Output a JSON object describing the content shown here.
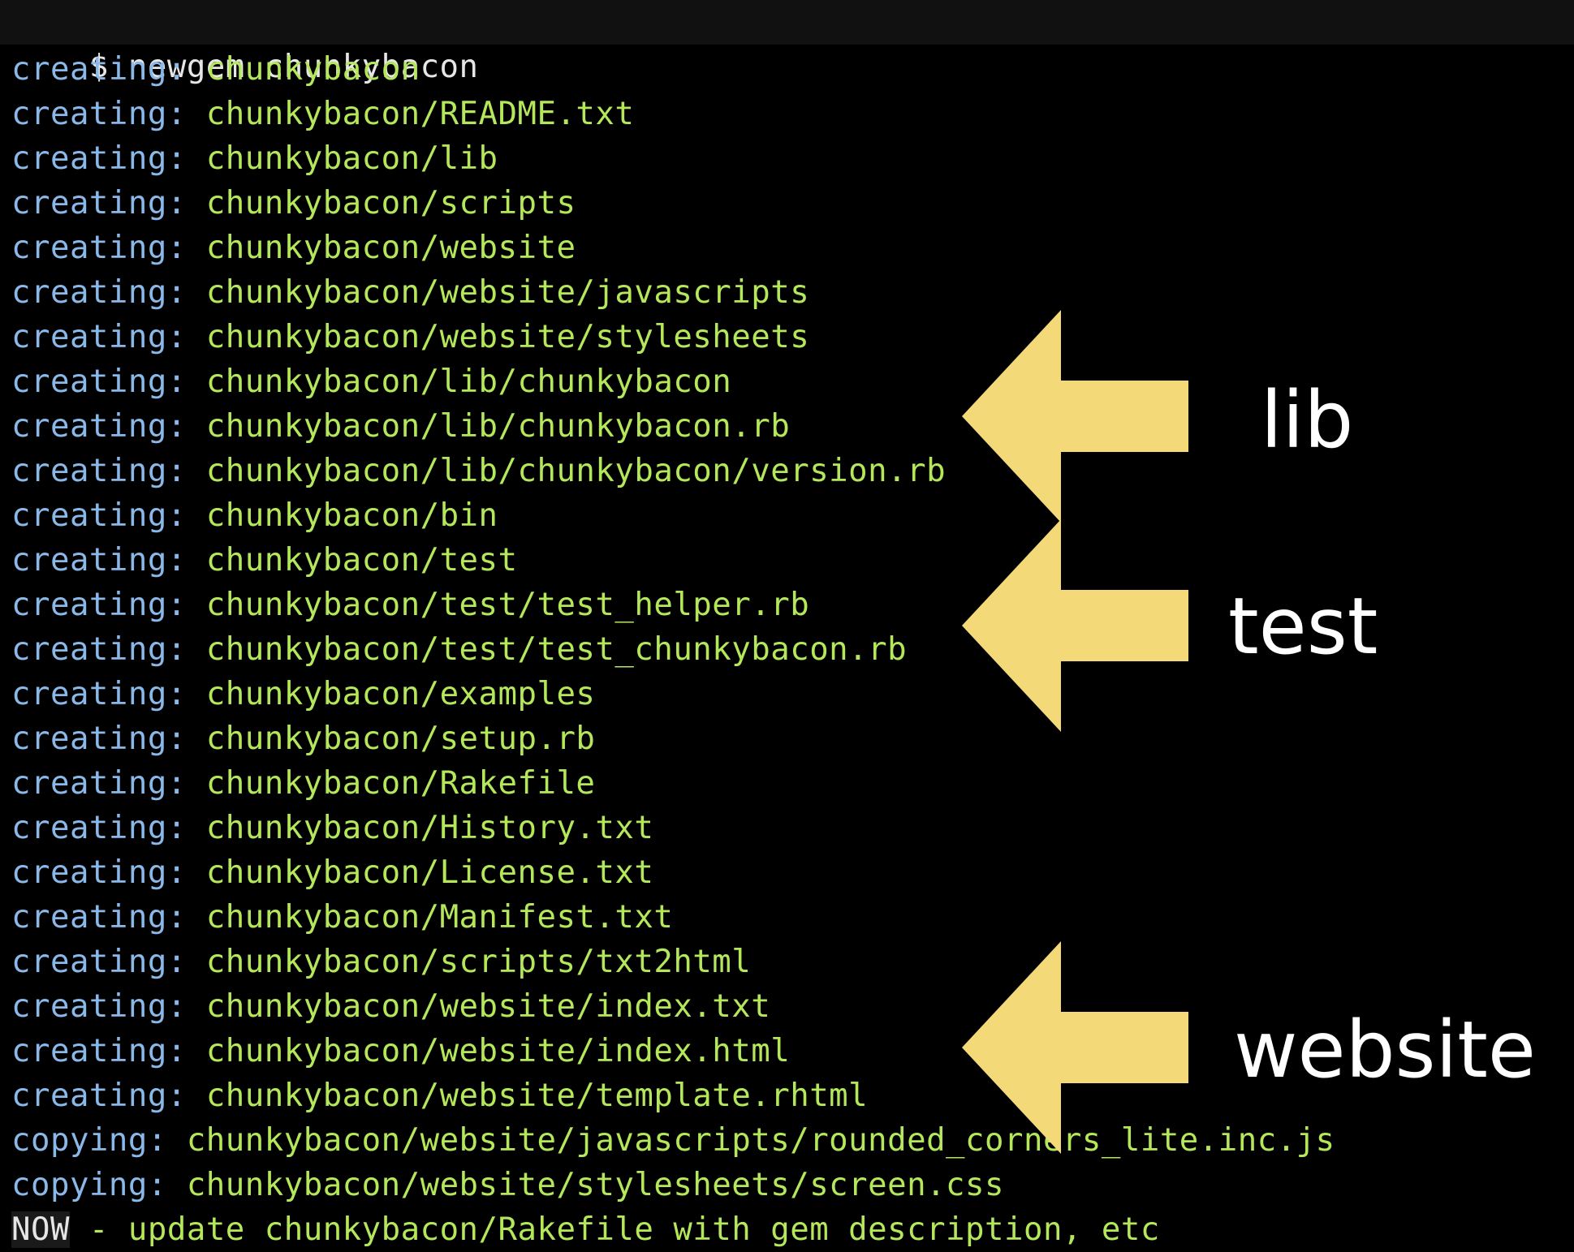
{
  "terminal": {
    "command": "$ newgem chunkybacon",
    "lines": [
      {
        "action": "creating:",
        "path": "chunkybacon"
      },
      {
        "action": "creating:",
        "path": "chunkybacon/README.txt"
      },
      {
        "action": "creating:",
        "path": "chunkybacon/lib"
      },
      {
        "action": "creating:",
        "path": "chunkybacon/scripts"
      },
      {
        "action": "creating:",
        "path": "chunkybacon/website"
      },
      {
        "action": "creating:",
        "path": "chunkybacon/website/javascripts"
      },
      {
        "action": "creating:",
        "path": "chunkybacon/website/stylesheets"
      },
      {
        "action": "creating:",
        "path": "chunkybacon/lib/chunkybacon"
      },
      {
        "action": "creating:",
        "path": "chunkybacon/lib/chunkybacon.rb"
      },
      {
        "action": "creating:",
        "path": "chunkybacon/lib/chunkybacon/version.rb"
      },
      {
        "action": "creating:",
        "path": "chunkybacon/bin"
      },
      {
        "action": "creating:",
        "path": "chunkybacon/test"
      },
      {
        "action": "creating:",
        "path": "chunkybacon/test/test_helper.rb"
      },
      {
        "action": "creating:",
        "path": "chunkybacon/test/test_chunkybacon.rb"
      },
      {
        "action": "creating:",
        "path": "chunkybacon/examples"
      },
      {
        "action": "creating:",
        "path": "chunkybacon/setup.rb"
      },
      {
        "action": "creating:",
        "path": "chunkybacon/Rakefile"
      },
      {
        "action": "creating:",
        "path": "chunkybacon/History.txt"
      },
      {
        "action": "creating:",
        "path": "chunkybacon/License.txt"
      },
      {
        "action": "creating:",
        "path": "chunkybacon/Manifest.txt"
      },
      {
        "action": "creating:",
        "path": "chunkybacon/scripts/txt2html"
      },
      {
        "action": "creating:",
        "path": "chunkybacon/website/index.txt"
      },
      {
        "action": "creating:",
        "path": "chunkybacon/website/index.html"
      },
      {
        "action": "creating:",
        "path": "chunkybacon/website/template.rhtml"
      },
      {
        "action": "copying:",
        "path": "chunkybacon/website/javascripts/rounded_corners_lite.inc.js"
      },
      {
        "action": "copying:",
        "path": "chunkybacon/website/stylesheets/screen.css"
      }
    ],
    "final_label": "NOW",
    "final_text": " - update chunkybacon/Rakefile with gem description, etc"
  },
  "annotations": [
    {
      "label": "lib",
      "icon": "left-arrow-icon"
    },
    {
      "label": "test",
      "icon": "left-arrow-icon"
    },
    {
      "label": "website",
      "icon": "left-arrow-icon"
    }
  ],
  "colors": {
    "background": "#000000",
    "action": "#8ab8e8",
    "path": "#b4e85a",
    "arrow": "#f3d978",
    "label": "#ffffff"
  }
}
